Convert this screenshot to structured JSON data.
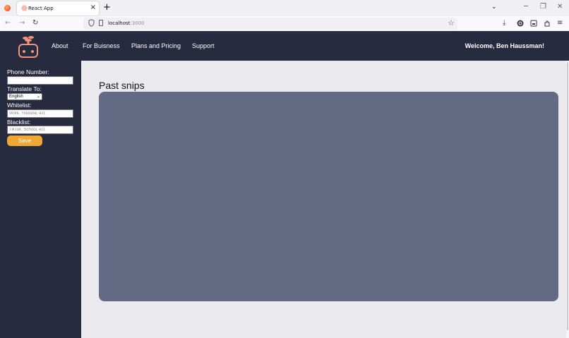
{
  "browser": {
    "tab_title": "React App",
    "tab_close": "×",
    "new_tab": "+",
    "url_host": "localhost",
    "url_port": ":3000",
    "tablist": "⌄",
    "minimize": "─",
    "restore": "❐",
    "close": "✕"
  },
  "header": {
    "nav_links": [
      "About",
      "For Buisness",
      "Plans and Pricing",
      "Support"
    ],
    "welcome": "Welcome, Ben Haussman!"
  },
  "sidebar": {
    "phone_label": "Phone Number:",
    "phone_value": "",
    "translate_label": "Translate To:",
    "translate_selected": "English",
    "whitelist_label": "Whitelist:",
    "whitelist_placeholder": "Work, Youtube, ect.",
    "blacklist_label": "Blacklist:",
    "blacklist_placeholder": "TikTok, School, ect.",
    "save_label": "Save"
  },
  "main": {
    "title": "Past snips"
  },
  "colors": {
    "app_dark": "#262b40",
    "panel": "#636a84",
    "accent": "#eea834",
    "main_bg": "#eaeaee"
  }
}
